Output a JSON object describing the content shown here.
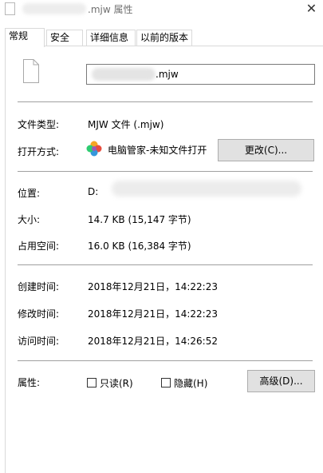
{
  "window": {
    "title_suffix": ".mjw 属性",
    "close_glyph": "✕"
  },
  "tabs": [
    {
      "label": "常规",
      "active": true
    },
    {
      "label": "安全",
      "active": false
    },
    {
      "label": "详细信息",
      "active": false
    },
    {
      "label": "以前的版本",
      "active": false
    }
  ],
  "file": {
    "name_suffix": ".mjw",
    "icon": "blank-file-icon"
  },
  "type": {
    "label": "文件类型:",
    "value": "MJW 文件 (.mjw)"
  },
  "open_with": {
    "label": "打开方式:",
    "app": "电脑管家-未知文件打开",
    "app_icon": "pinwheel-app-icon",
    "change_button": "更改(C)..."
  },
  "location": {
    "label": "位置:",
    "value": "D:"
  },
  "size": {
    "label": "大小:",
    "value": "14.7 KB (15,147 字节)"
  },
  "size_on_disk": {
    "label": "占用空间:",
    "value": "16.0 KB (16,384 字节)"
  },
  "created": {
    "label": "创建时间:",
    "value": "2018年12月21日，14:22:23"
  },
  "modified": {
    "label": "修改时间:",
    "value": "2018年12月21日，14:22:23"
  },
  "accessed": {
    "label": "访问时间:",
    "value": "2018年12月21日，14:26:52"
  },
  "attributes": {
    "label": "属性:",
    "readonly": "只读(R)",
    "readonly_checked": false,
    "hidden": "隐藏(H)",
    "hidden_checked": false,
    "advanced_button": "高级(D)..."
  }
}
